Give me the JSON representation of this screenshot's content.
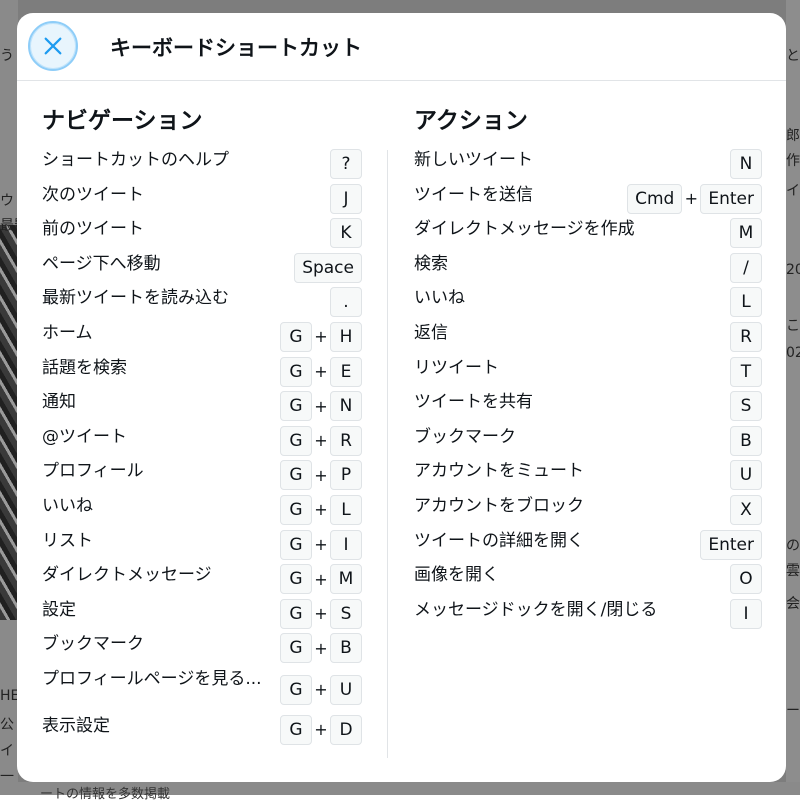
{
  "modal": {
    "title": "キーボードショートカット"
  },
  "background": {
    "left_fragments": [
      "う",
      "ウ",
      "最影",
      "HE",
      "公",
      "イ",
      "一",
      "ト"
    ],
    "right_fragments": [
      "と",
      "郎",
      "作視",
      "イ",
      "20",
      "こ",
      "02",
      "の",
      "雲",
      "会",
      "ート"
    ],
    "bottom_fragment": "ートの情報を多数掲載"
  },
  "navigation": {
    "title": "ナビゲーション",
    "shortcuts": [
      {
        "label": "ショートカットのヘルプ",
        "keys": [
          "?"
        ]
      },
      {
        "label": "次のツイート",
        "keys": [
          "J"
        ]
      },
      {
        "label": "前のツイート",
        "keys": [
          "K"
        ]
      },
      {
        "label": "ページ下へ移動",
        "keys": [
          "Space"
        ]
      },
      {
        "label": "最新ツイートを読み込む",
        "keys": [
          "."
        ]
      },
      {
        "label": "ホーム",
        "keys": [
          "G",
          "H"
        ]
      },
      {
        "label": "話題を検索",
        "keys": [
          "G",
          "E"
        ]
      },
      {
        "label": "通知",
        "keys": [
          "G",
          "N"
        ]
      },
      {
        "label": "@ツイート",
        "keys": [
          "G",
          "R"
        ]
      },
      {
        "label": "プロフィール",
        "keys": [
          "G",
          "P"
        ]
      },
      {
        "label": "いいね",
        "keys": [
          "G",
          "L"
        ]
      },
      {
        "label": "リスト",
        "keys": [
          "G",
          "I"
        ]
      },
      {
        "label": "ダイレクトメッセージ",
        "keys": [
          "G",
          "M"
        ]
      },
      {
        "label": "設定",
        "keys": [
          "G",
          "S"
        ]
      },
      {
        "label": "ブックマーク",
        "keys": [
          "G",
          "B"
        ]
      },
      {
        "label": "プロフィールページを見る...",
        "keys": [
          "G",
          "U"
        ]
      },
      {
        "label": "表示設定",
        "keys": [
          "G",
          "D"
        ]
      }
    ]
  },
  "actions": {
    "title": "アクション",
    "shortcuts": [
      {
        "label": "新しいツイート",
        "keys": [
          "N"
        ]
      },
      {
        "label": "ツイートを送信",
        "keys": [
          "Cmd",
          "Enter"
        ]
      },
      {
        "label": "ダイレクトメッセージを作成",
        "keys": [
          "M"
        ]
      },
      {
        "label": "検索",
        "keys": [
          "/"
        ]
      },
      {
        "label": "いいね",
        "keys": [
          "L"
        ]
      },
      {
        "label": "返信",
        "keys": [
          "R"
        ]
      },
      {
        "label": "リツイート",
        "keys": [
          "T"
        ]
      },
      {
        "label": "ツイートを共有",
        "keys": [
          "S"
        ]
      },
      {
        "label": "ブックマーク",
        "keys": [
          "B"
        ]
      },
      {
        "label": "アカウントをミュート",
        "keys": [
          "U"
        ]
      },
      {
        "label": "アカウントをブロック",
        "keys": [
          "X"
        ]
      },
      {
        "label": "ツイートの詳細を開く",
        "keys": [
          "Enter"
        ]
      },
      {
        "label": "画像を開く",
        "keys": [
          "O"
        ]
      },
      {
        "label": "メッセージドックを開く/閉じる",
        "keys": [
          "I"
        ]
      }
    ]
  },
  "key_separator": "+",
  "colors": {
    "accent": "#1d9bf0",
    "close_bg": "#e8f5fd",
    "key_bg": "#f7f9f9",
    "key_border": "#dfe3e6",
    "divider": "#e1e4e7"
  }
}
